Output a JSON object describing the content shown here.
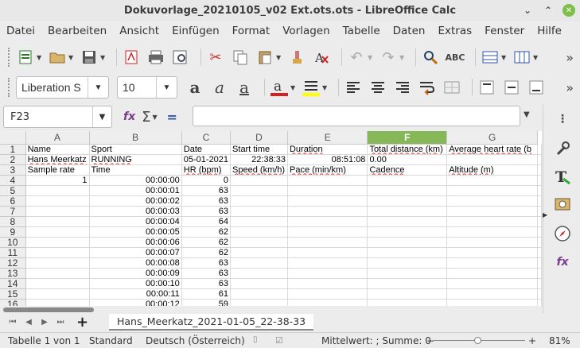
{
  "window": {
    "title": "Dokuvorlage_20210105_v02 Ext.ots.ots - LibreOffice Calc"
  },
  "menu": [
    "Datei",
    "Bearbeiten",
    "Ansicht",
    "Einfügen",
    "Format",
    "Vorlagen",
    "Tabelle",
    "Daten",
    "Extras",
    "Fenster",
    "Hilfe"
  ],
  "formatting": {
    "font_name": "Liberation S",
    "font_size": "10",
    "font_color": "#d42020",
    "highlight_color": "#ffff00"
  },
  "formula_bar": {
    "cell_ref": "F23",
    "formula": ""
  },
  "grid": {
    "columns": [
      "A",
      "B",
      "C",
      "D",
      "E",
      "F",
      "G"
    ],
    "selected_column": "F",
    "rows": [
      {
        "n": "1",
        "cells": [
          "Name",
          "Sport",
          "Date",
          "Start time",
          "Duration",
          "Total distance (km)",
          "Average heart rate (b"
        ]
      },
      {
        "n": "2",
        "cells": [
          "Hans Meerkatz",
          "RUNNING",
          "05-01-2021",
          "22:38:33",
          "08:51:08",
          "0.00",
          ""
        ]
      },
      {
        "n": "3",
        "cells": [
          "Sample rate",
          "Time",
          "HR (bpm)",
          "Speed (km/h)",
          "Pace (min/km)",
          "Cadence",
          "Altitude (m)"
        ]
      },
      {
        "n": "4",
        "cells": [
          "1",
          "00:00:00",
          "0",
          "",
          "",
          "",
          ""
        ]
      },
      {
        "n": "5",
        "cells": [
          "",
          "00:00:01",
          "63",
          "",
          "",
          "",
          ""
        ]
      },
      {
        "n": "6",
        "cells": [
          "",
          "00:00:02",
          "63",
          "",
          "",
          "",
          ""
        ]
      },
      {
        "n": "7",
        "cells": [
          "",
          "00:00:03",
          "63",
          "",
          "",
          "",
          ""
        ]
      },
      {
        "n": "8",
        "cells": [
          "",
          "00:00:04",
          "64",
          "",
          "",
          "",
          ""
        ]
      },
      {
        "n": "9",
        "cells": [
          "",
          "00:00:05",
          "62",
          "",
          "",
          "",
          ""
        ]
      },
      {
        "n": "10",
        "cells": [
          "",
          "00:00:06",
          "62",
          "",
          "",
          "",
          ""
        ]
      },
      {
        "n": "11",
        "cells": [
          "",
          "00:00:07",
          "62",
          "",
          "",
          "",
          ""
        ]
      },
      {
        "n": "12",
        "cells": [
          "",
          "00:00:08",
          "63",
          "",
          "",
          "",
          ""
        ]
      },
      {
        "n": "13",
        "cells": [
          "",
          "00:00:09",
          "63",
          "",
          "",
          "",
          ""
        ]
      },
      {
        "n": "14",
        "cells": [
          "",
          "00:00:10",
          "63",
          "",
          "",
          "",
          ""
        ]
      },
      {
        "n": "15",
        "cells": [
          "",
          "00:00:11",
          "61",
          "",
          "",
          "",
          ""
        ]
      },
      {
        "n": "16",
        "cells": [
          "",
          "00:00:12",
          "59",
          "",
          "",
          "",
          ""
        ]
      }
    ]
  },
  "sheet_tabs": {
    "active": "Hans_Meerkatz_2021-01-05_22-38-33"
  },
  "status_bar": {
    "sheet": "Tabelle 1 von 1",
    "page_style": "Standard",
    "language": "Deutsch (Österreich)",
    "summary": "Mittelwert: ; Summe: 0",
    "zoom": "81%"
  }
}
